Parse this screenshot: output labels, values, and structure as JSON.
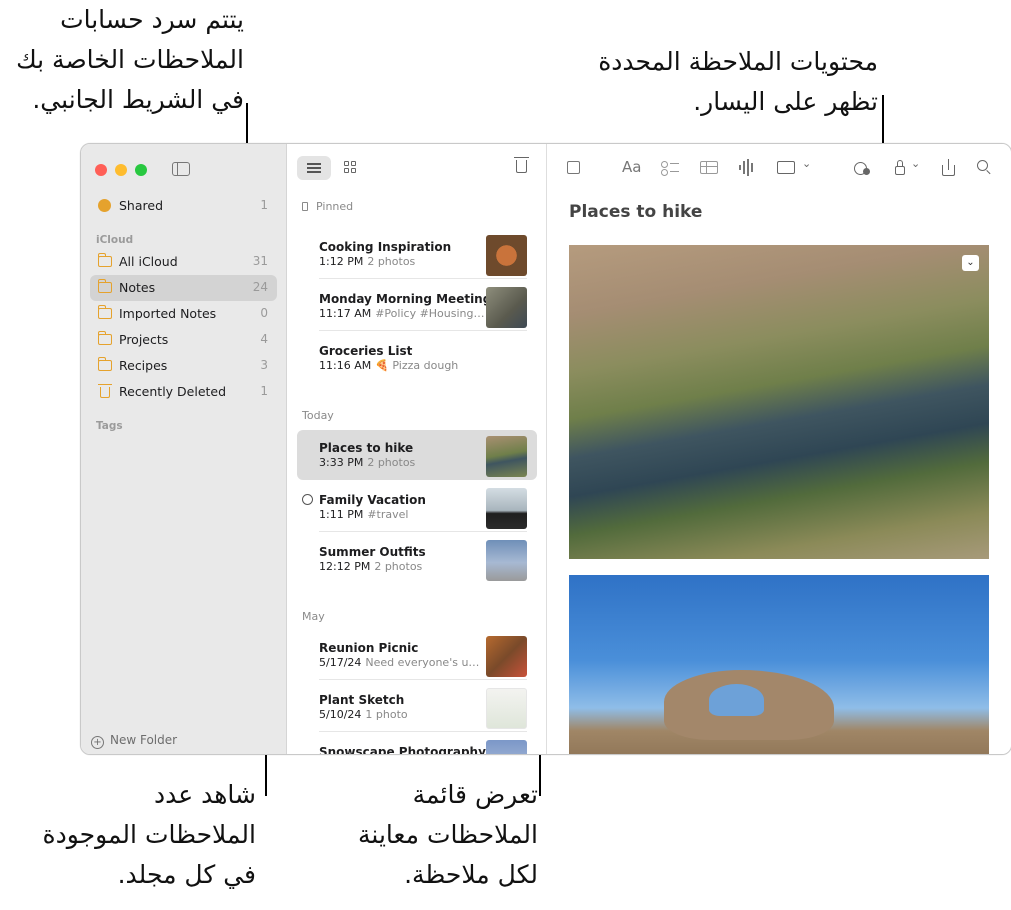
{
  "callouts": {
    "sidebar_accounts": [
      "يتتم سرد حسابات",
      "الملاحظات الخاصة بك",
      "في الشريط الجانبي."
    ],
    "note_contents": [
      "محتويات الملاحظة المحددة",
      "تظهر على اليسار."
    ],
    "folder_counts": [
      "شاهد عدد",
      "الملاحظات الموجودة",
      "في كل مجلد."
    ],
    "note_preview": [
      "تعرض قائمة",
      "الملاحظات معاينة",
      "لكل ملاحظة."
    ]
  },
  "sidebar": {
    "shared": {
      "label": "Shared",
      "count": "1"
    },
    "icloud_heading": "iCloud",
    "folders": [
      {
        "label": "All iCloud",
        "count": "31"
      },
      {
        "label": "Notes",
        "count": "24"
      },
      {
        "label": "Imported Notes",
        "count": "0"
      },
      {
        "label": "Projects",
        "count": "4"
      },
      {
        "label": "Recipes",
        "count": "3"
      },
      {
        "label": "Recently Deleted",
        "count": "1"
      }
    ],
    "tags_heading": "Tags",
    "new_folder": "New Folder"
  },
  "notelist": {
    "sections": {
      "pinned": "Pinned",
      "today": "Today",
      "may": "May"
    },
    "notes": [
      {
        "title": "Cooking Inspiration",
        "time": "1:12 PM",
        "preview": "2 photos"
      },
      {
        "title": "Monday Morning Meeting",
        "time": "11:17 AM",
        "preview": "#Policy #Housing…"
      },
      {
        "title": "Groceries List",
        "time": "11:16 AM",
        "preview": "🍕 Pizza dough"
      },
      {
        "title": "Places to hike",
        "time": "3:33 PM",
        "preview": "2 photos"
      },
      {
        "title": "Family Vacation",
        "time": "1:11 PM",
        "preview": "#travel"
      },
      {
        "title": "Summer Outfits",
        "time": "12:12 PM",
        "preview": "2 photos"
      },
      {
        "title": "Reunion Picnic",
        "time": "5/17/24",
        "preview": "Need everyone's u…"
      },
      {
        "title": "Plant Sketch",
        "time": "5/10/24",
        "preview": "1 photo"
      },
      {
        "title": "Snowscape Photography",
        "time": "",
        "preview": ""
      }
    ]
  },
  "editor": {
    "title": "Places to hike",
    "format_label": "Aa"
  },
  "colors": {
    "folder": "#e5a22d",
    "selected_row": "#d3d3d3",
    "sidebar_bg": "#e9e9e9"
  }
}
